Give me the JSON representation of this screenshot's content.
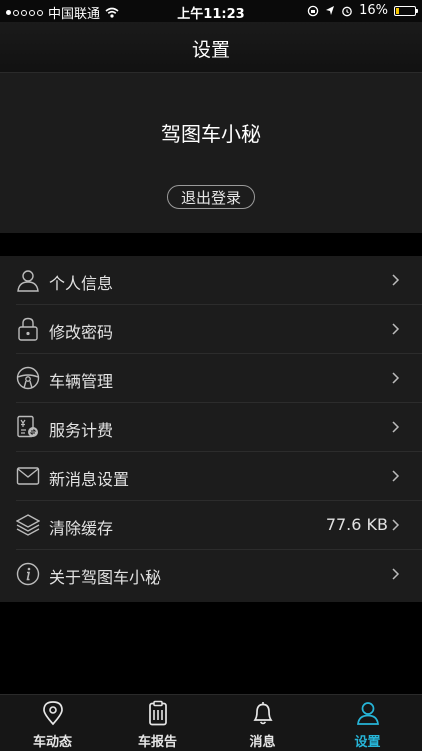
{
  "status_bar": {
    "carrier": "中国联通",
    "time": "上午11:23",
    "battery_percent": "16%",
    "battery_level": 0.16,
    "battery_color": "#f5c400"
  },
  "nav": {
    "title": "设置"
  },
  "profile": {
    "name": "驾图车小秘",
    "logout_label": "退出登录"
  },
  "menu": {
    "items": [
      {
        "label": "个人信息",
        "icon": "person-icon",
        "value": ""
      },
      {
        "label": "修改密码",
        "icon": "lock-icon",
        "value": ""
      },
      {
        "label": "车辆管理",
        "icon": "steering-wheel-icon",
        "value": ""
      },
      {
        "label": "服务计费",
        "icon": "billing-icon",
        "value": ""
      },
      {
        "label": "新消息设置",
        "icon": "mail-icon",
        "value": ""
      },
      {
        "label": "清除缓存",
        "icon": "layers-icon",
        "value": "77.6 KB"
      },
      {
        "label": "关于驾图车小秘",
        "icon": "info-icon",
        "value": ""
      }
    ]
  },
  "tabbar": {
    "accent": "#26b5d8",
    "tabs": [
      {
        "label": "车动态",
        "icon": "location-pin-icon",
        "active": false
      },
      {
        "label": "车报告",
        "icon": "clipboard-icon",
        "active": false
      },
      {
        "label": "消息",
        "icon": "bell-icon",
        "active": false
      },
      {
        "label": "设置",
        "icon": "person-icon",
        "active": true
      }
    ]
  }
}
